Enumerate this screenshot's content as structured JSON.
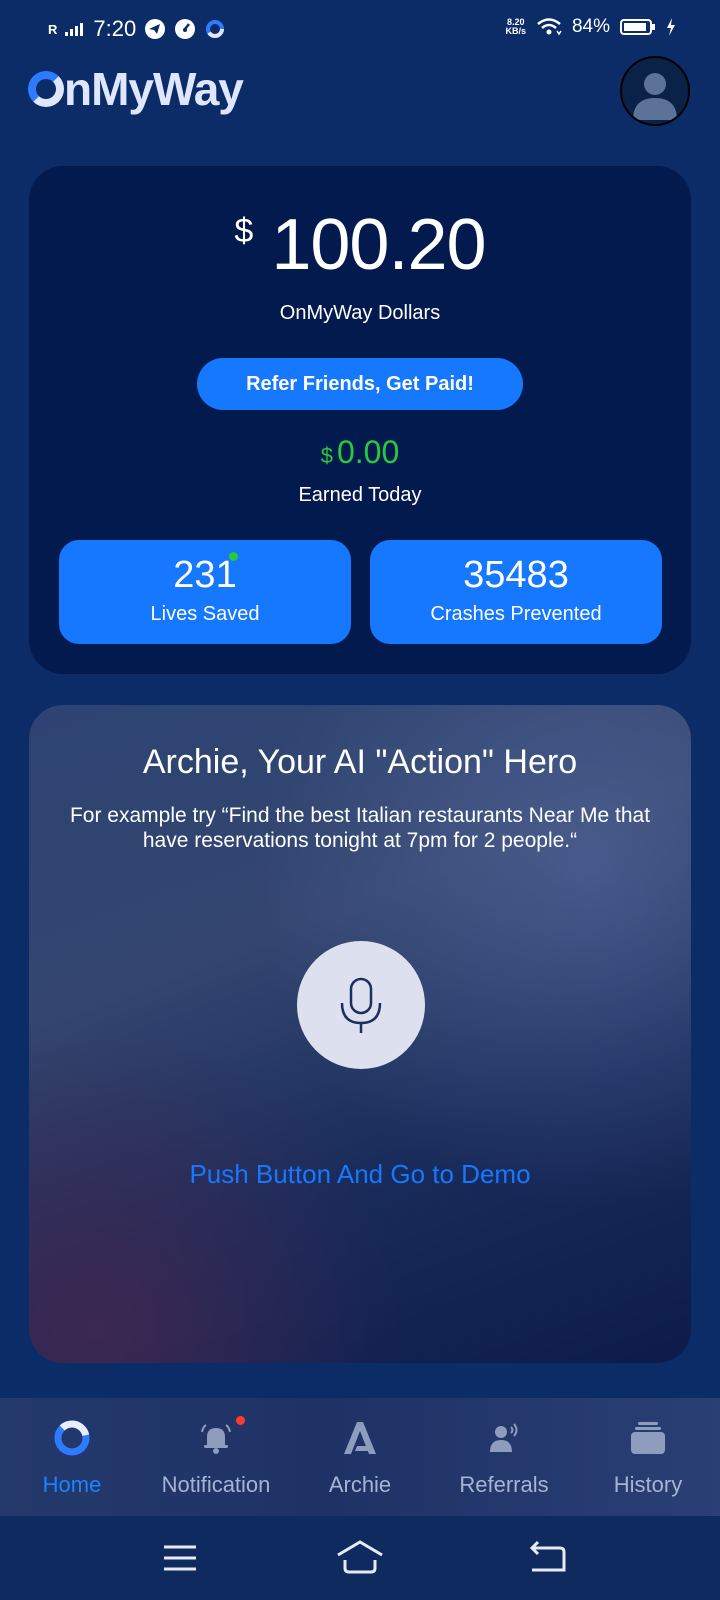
{
  "status_bar": {
    "carrier_indicator": "R",
    "time": "7:20",
    "net_speed_value": "8.20",
    "net_speed_unit": "KB/s",
    "battery_percent": "84%"
  },
  "header": {
    "logo_text": "nMyWay",
    "avatar_icon": "user-avatar-icon"
  },
  "balance_card": {
    "currency_symbol": "$",
    "balance": "100.20",
    "balance_label": "OnMyWay Dollars",
    "refer_button_label": "Refer Friends, Get Paid!",
    "today_currency": "$",
    "today_amount": "0.00",
    "today_label": "Earned Today",
    "stats": [
      {
        "value": "231",
        "label": "Lives Saved"
      },
      {
        "value": "35483",
        "label": "Crashes Prevented"
      }
    ]
  },
  "archie_card": {
    "title": "Archie, Your AI \"Action\" Hero",
    "description": "For example try “Find the best Italian restaurants Near Me that have reservations tonight at 7pm for 2 people.“",
    "mic_icon": "microphone-icon",
    "demo_link": "Push Button And Go to Demo"
  },
  "bottom_nav": {
    "items": [
      {
        "label": "Home",
        "icon": "home-ring-icon",
        "active": true
      },
      {
        "label": "Notification",
        "icon": "bell-icon",
        "active": false
      },
      {
        "label": "Archie",
        "icon": "archie-a-icon",
        "active": false
      },
      {
        "label": "Referrals",
        "icon": "referral-person-icon",
        "active": false
      },
      {
        "label": "History",
        "icon": "history-stack-icon",
        "active": false
      }
    ]
  },
  "system_nav": {
    "icons": [
      "menu-icon",
      "home-icon",
      "back-icon"
    ]
  },
  "colors": {
    "background": "#0b2c66",
    "card": "#031a4e",
    "accent": "#1677ff",
    "positive": "#27c93f",
    "notification_dot": "#ff3b30"
  }
}
